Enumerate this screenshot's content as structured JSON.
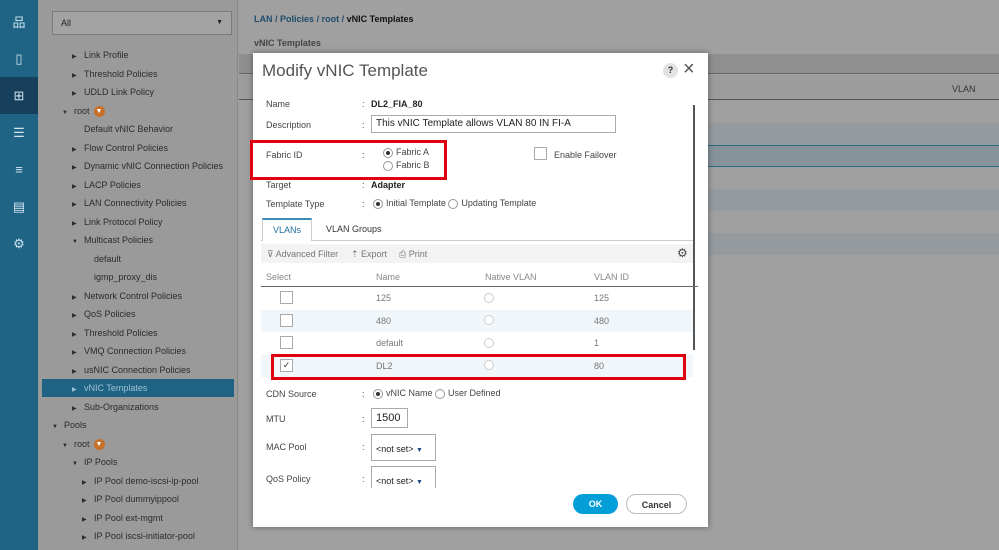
{
  "iconbar": {
    "items": [
      {
        "icon": "network-topology-icon"
      },
      {
        "icon": "server-icon"
      },
      {
        "icon": "lan-icon",
        "active": true
      },
      {
        "icon": "storage-icon"
      },
      {
        "icon": "chassis-icon"
      },
      {
        "icon": "list-icon"
      },
      {
        "icon": "admin-icon"
      }
    ]
  },
  "nav": {
    "filter": "All",
    "tree": [
      {
        "label": "Link Profile",
        "depth": 2,
        "arrow": "right"
      },
      {
        "label": "Threshold Policies",
        "depth": 2,
        "arrow": "right"
      },
      {
        "label": "UDLD Link Policy",
        "depth": 2,
        "arrow": "right"
      },
      {
        "label": "root",
        "depth": 1,
        "arrow": "down",
        "org": true
      },
      {
        "label": "Default vNIC Behavior",
        "depth": 2,
        "arrow": "none"
      },
      {
        "label": "Flow Control Policies",
        "depth": 2,
        "arrow": "right"
      },
      {
        "label": "Dynamic vNIC Connection Policies",
        "depth": 2,
        "arrow": "right"
      },
      {
        "label": "LACP Policies",
        "depth": 2,
        "arrow": "right"
      },
      {
        "label": "LAN Connectivity Policies",
        "depth": 2,
        "arrow": "right"
      },
      {
        "label": "Link Protocol Policy",
        "depth": 2,
        "arrow": "right"
      },
      {
        "label": "Multicast Policies",
        "depth": 2,
        "arrow": "down"
      },
      {
        "label": "default",
        "depth": 3,
        "arrow": "none"
      },
      {
        "label": "igmp_proxy_dis",
        "depth": 3,
        "arrow": "none"
      },
      {
        "label": "Network Control Policies",
        "depth": 2,
        "arrow": "right"
      },
      {
        "label": "QoS Policies",
        "depth": 2,
        "arrow": "right"
      },
      {
        "label": "Threshold Policies",
        "depth": 2,
        "arrow": "right"
      },
      {
        "label": "VMQ Connection Policies",
        "depth": 2,
        "arrow": "right"
      },
      {
        "label": "usNIC Connection Policies",
        "depth": 2,
        "arrow": "right"
      },
      {
        "label": "vNIC Templates",
        "depth": 2,
        "arrow": "right",
        "selected": true
      },
      {
        "label": "Sub-Organizations",
        "depth": 2,
        "arrow": "right"
      },
      {
        "label": "Pools",
        "depth": 0,
        "arrow": "down"
      },
      {
        "label": "root",
        "depth": 1,
        "arrow": "down",
        "org": true
      },
      {
        "label": "IP Pools",
        "depth": 2,
        "arrow": "down"
      },
      {
        "label": "IP Pool demo-iscsi-ip-pool",
        "depth": 3,
        "arrow": "right"
      },
      {
        "label": "IP Pool dummyippool",
        "depth": 3,
        "arrow": "right"
      },
      {
        "label": "IP Pool ext-mgmt",
        "depth": 3,
        "arrow": "right"
      },
      {
        "label": "IP Pool iscsi-initiator-pool",
        "depth": 3,
        "arrow": "right"
      }
    ]
  },
  "breadcrumb": {
    "parts": [
      "LAN",
      "Policies",
      "root"
    ],
    "current": "vNIC Templates",
    "sep": "/"
  },
  "section_title": "vNIC Templates",
  "bg_table": {
    "col_vlan": "VLAN"
  },
  "modal": {
    "title": "Modify vNIC Template",
    "help": "?",
    "close": "×",
    "name_label": "Name",
    "name_value": "DL2_FIA_80",
    "desc_label": "Description",
    "desc_value": "This vNIC Template allows VLAN 80 IN FI-A",
    "fabric_label": "Fabric ID",
    "fabric_a": "Fabric A",
    "fabric_b": "Fabric B",
    "fabric_selected": "Fabric A",
    "failover_label": "Enable Failover",
    "failover_checked": false,
    "target_label": "Target",
    "target_value": "Adapter",
    "ttype_label": "Template Type",
    "ttype_initial": "Initial Template",
    "ttype_updating": "Updating Template",
    "ttype_selected": "Initial Template",
    "tabs": [
      "VLANs",
      "VLAN Groups"
    ],
    "active_tab": "VLANs",
    "toolbar": {
      "filter": "Advanced Filter",
      "export": "Export",
      "print": "Print"
    },
    "columns": [
      "Select",
      "Name",
      "Native VLAN",
      "VLAN ID"
    ],
    "rows": [
      {
        "name": "125",
        "vlan_id": "125",
        "selected": false
      },
      {
        "name": "480",
        "vlan_id": "480",
        "selected": false
      },
      {
        "name": "default",
        "vlan_id": "1",
        "selected": false
      },
      {
        "name": "DL2",
        "vlan_id": "80",
        "selected": true
      }
    ],
    "cdn_label": "CDN Source",
    "cdn_vnic": "vNIC Name",
    "cdn_user": "User Defined",
    "cdn_selected": "vNIC Name",
    "mtu_label": "MTU",
    "mtu_value": "1500",
    "mac_label": "MAC Pool",
    "mac_value": "<not set>",
    "qos_label": "QoS Policy",
    "qos_value": "<not set>",
    "ok": "OK",
    "cancel": "Cancel",
    "colon": ":"
  },
  "colors": {
    "accent": "#1f6485",
    "ok": "#049fd9",
    "highlight": "#e00010"
  }
}
